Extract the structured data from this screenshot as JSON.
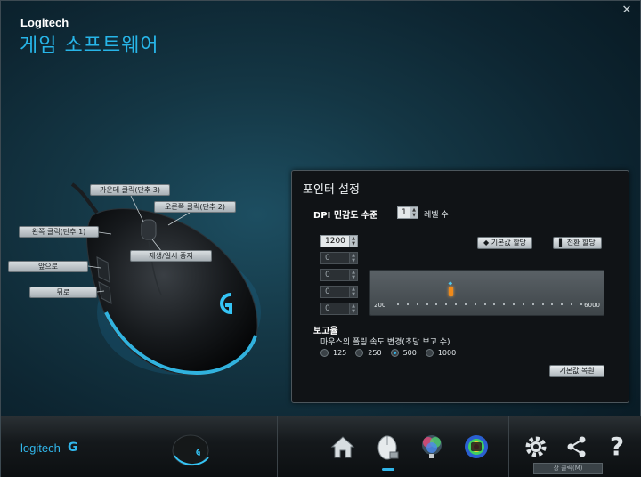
{
  "window": {
    "close_glyph": "✕",
    "brand": "Logitech",
    "title": "게임 소프트웨어"
  },
  "mouse_callouts": {
    "middle_click": "가운데 클릭(단추 3)",
    "right_click": "오른쪽 클릭(단추 2)",
    "left_click": "왼쪽 클릭(단추 1)",
    "play_pause": "재생/일시 중지",
    "forward": "앞으로",
    "back": "뒤로"
  },
  "pointer_panel": {
    "title": "포인터 설정",
    "dpi_label": "DPI 민감도 수준",
    "dpi_levels_value": "1",
    "levels_label": "레벨 수",
    "default_button": "◆ 기본값 할당",
    "shift_button": "▌ 전환 할당",
    "dpi_values": [
      "1200",
      "0",
      "0",
      "0",
      "0"
    ],
    "slider": {
      "min": "200",
      "max": "6000",
      "value": 1200
    },
    "report_title": "보고율",
    "report_desc": "마우스의 폴링 속도 변경(초당 보고 수)",
    "report_options": [
      "125",
      "250",
      "500",
      "1000"
    ],
    "report_selected": "500",
    "restore_button": "기본값 복원"
  },
  "bottom_bar": {
    "logo_text": "logitech",
    "logo_mark": "G",
    "icons": [
      "home-icon",
      "mouse-pointer-settings-icon",
      "lighting-icon",
      "heatmap-icon",
      "settings-gear-icon",
      "share-icon",
      "help-icon"
    ],
    "active_icon": "mouse-pointer-settings-icon",
    "help_glyph": "?",
    "tooltip": "장 클릭(M)"
  },
  "colors": {
    "accent": "#31b6ea",
    "slider_thumb": "#f08a1a"
  }
}
